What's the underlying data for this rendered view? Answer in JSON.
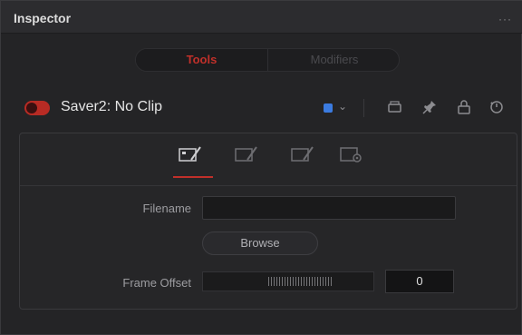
{
  "header": {
    "title": "Inspector",
    "more": "···"
  },
  "tabs": {
    "tools": "Tools",
    "modifiers": "Modifiers"
  },
  "node": {
    "name": "Saver2: No Clip",
    "enabled": true,
    "color": "#3b7be0"
  },
  "control_tabs": [
    {
      "icon": "file-pen-icon",
      "active": true
    },
    {
      "icon": "file-pen-icon-2",
      "active": false
    },
    {
      "icon": "file-pen-icon-3",
      "active": false
    },
    {
      "icon": "settings-gear-icon",
      "active": false
    }
  ],
  "fields": {
    "filename": {
      "label": "Filename",
      "value": ""
    },
    "browse": {
      "label": "Browse"
    },
    "frame_offset": {
      "label": "Frame Offset",
      "value": "0"
    }
  },
  "colors": {
    "accent": "#c0302a",
    "panel": "#242426"
  }
}
